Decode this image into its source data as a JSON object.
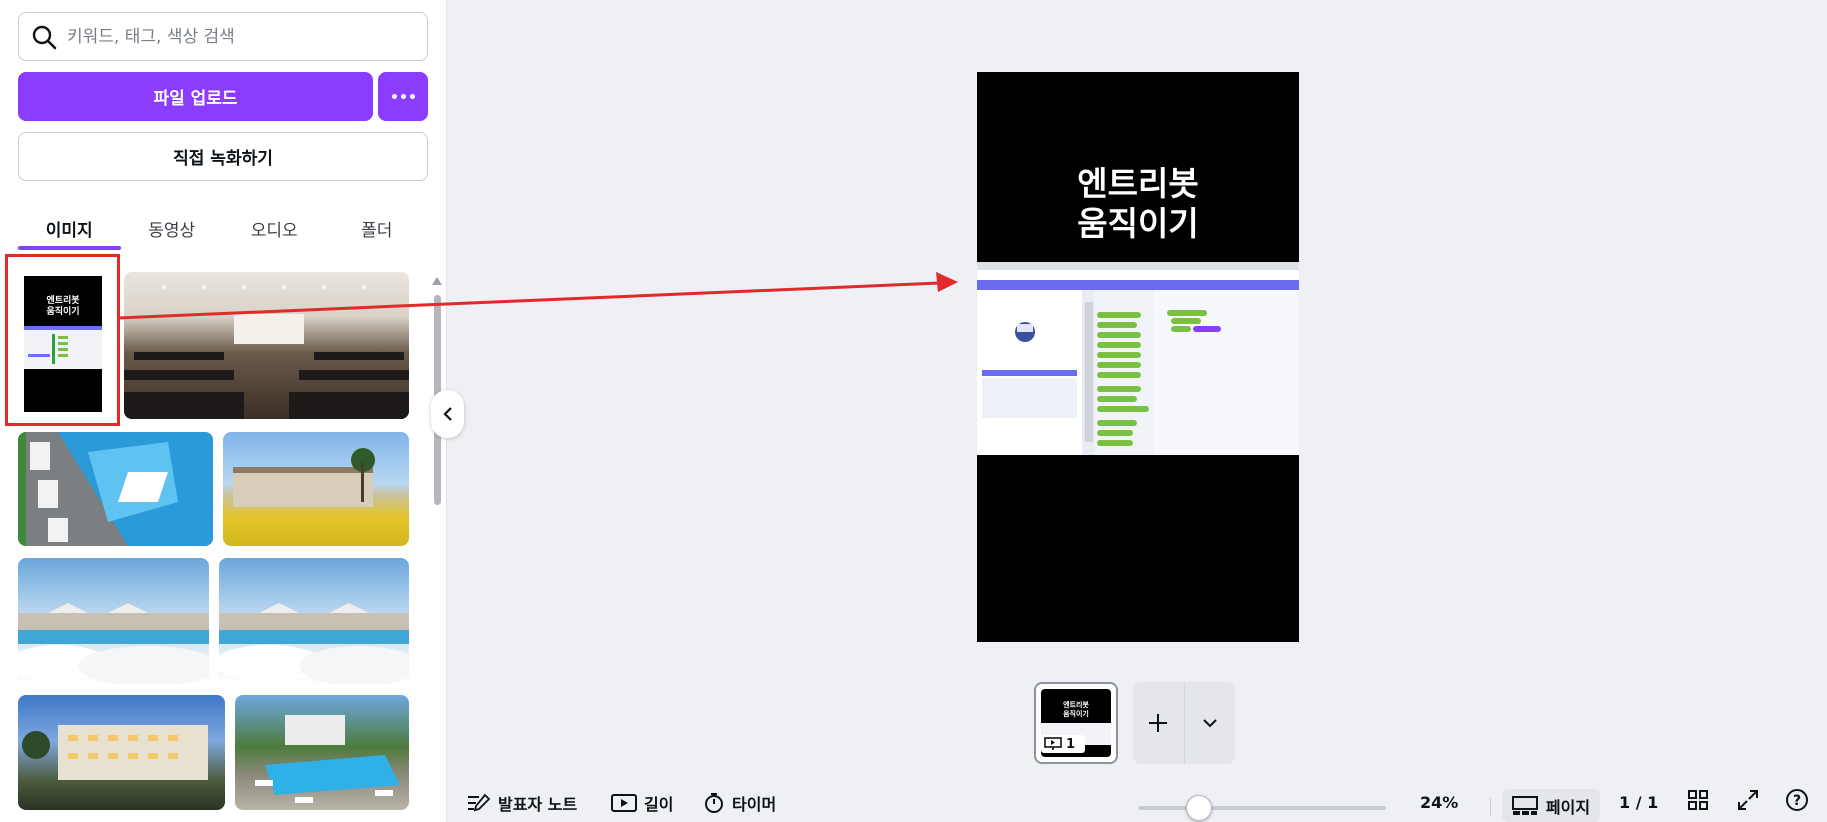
{
  "search": {
    "placeholder": "키워드, 태그, 색상 검색",
    "icon": "search-icon"
  },
  "upload": {
    "label": "파일 업로드",
    "more_icon": "more-dots-icon"
  },
  "record": {
    "label": "직접 녹화하기"
  },
  "tabs": [
    {
      "label": "이미지",
      "active": true
    },
    {
      "label": "동영상",
      "active": false
    },
    {
      "label": "오디오",
      "active": false
    },
    {
      "label": "폴더",
      "active": false
    }
  ],
  "uploaded_design": {
    "title_line1": "엔트리봇",
    "title_line2": "움직이기"
  },
  "canvas": {
    "title_line1": "엔트리봇",
    "title_line2": "움직이기"
  },
  "page_strip": {
    "thumb_line1": "엔트리봇",
    "thumb_line2": "움직이기",
    "page_number": "1"
  },
  "footer": {
    "notes": "발표자 노트",
    "length": "길이",
    "timer": "타이머",
    "zoom": "24%",
    "pages_label": "페이지",
    "page_count": "1 / 1"
  },
  "zoom_level": 0.24,
  "colors": {
    "accent": "#8b3dff",
    "highlight": "#e22a2a",
    "arrow": "#e22a2a"
  }
}
